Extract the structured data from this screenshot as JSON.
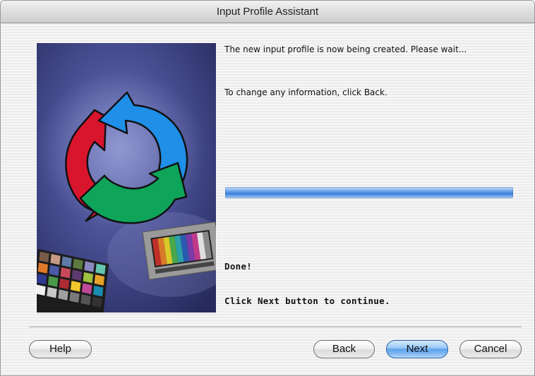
{
  "window": {
    "title": "Input Profile Assistant"
  },
  "messages": {
    "line1": "The new input profile is now being created. Please wait...",
    "line2": "To change any information, click Back.",
    "done": "Done!",
    "instruction": "Click Next button to continue."
  },
  "progress": {
    "value_percent": 100
  },
  "buttons": {
    "help": "Help",
    "back": "Back",
    "next": "Next",
    "cancel": "Cancel"
  },
  "colors": {
    "arrow_red": "#d9152e",
    "arrow_blue": "#1f8fe8",
    "arrow_green": "#0ea45a",
    "default_button": "#5fa2ea"
  }
}
